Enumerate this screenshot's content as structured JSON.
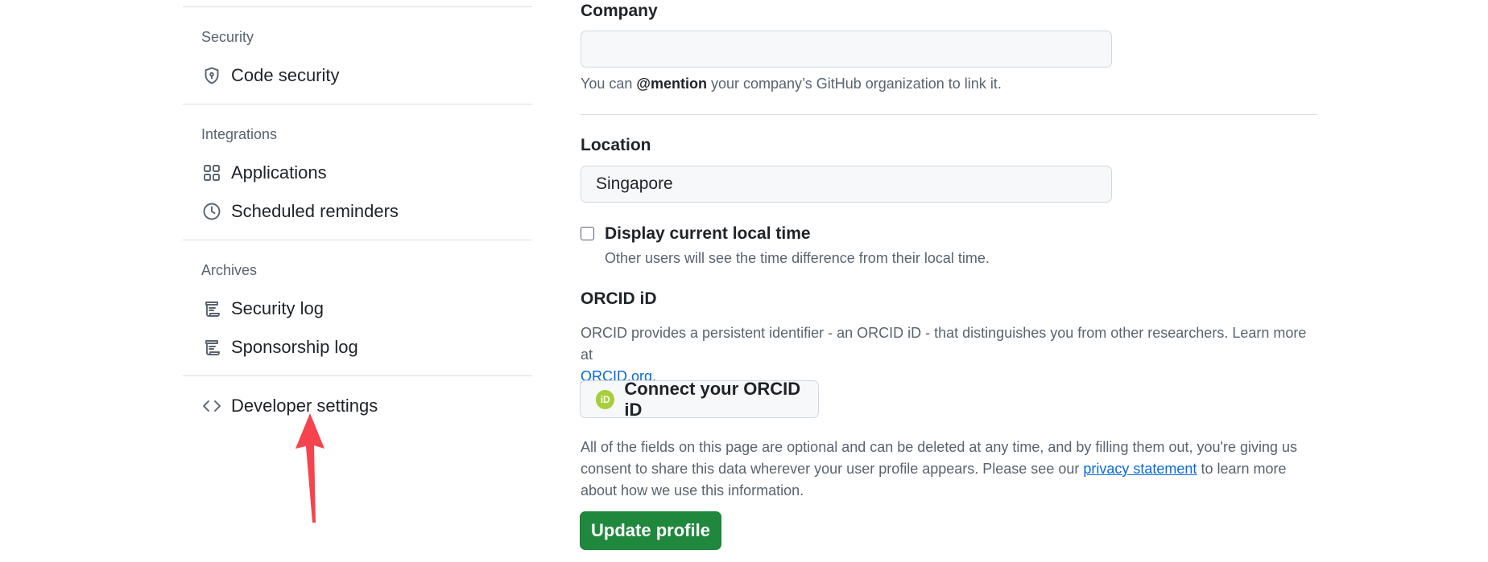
{
  "sidebar": {
    "security_header": "Security",
    "code_security": "Code security",
    "integrations_header": "Integrations",
    "applications": "Applications",
    "scheduled_reminders": "Scheduled reminders",
    "archives_header": "Archives",
    "security_log": "Security log",
    "sponsorship_log": "Sponsorship log",
    "developer_settings": "Developer settings"
  },
  "main": {
    "company": {
      "label": "Company",
      "value": "",
      "hint_prefix": "You can ",
      "hint_mention": "@mention",
      "hint_suffix": " your company’s GitHub organization to link it."
    },
    "location": {
      "label": "Location",
      "value": "Singapore"
    },
    "local_time": {
      "checked": false,
      "label": "Display current local time",
      "hint": "Other users will see the time difference from their local time."
    },
    "orcid": {
      "heading": "ORCID iD",
      "desc": "ORCID provides a persistent identifier - an ORCID iD - that distinguishes you from other researchers. Learn more at",
      "link": "ORCID.org",
      "link_suffix": ".",
      "logo_text": "iD",
      "button": "Connect your ORCID iD"
    },
    "footer_note": {
      "prefix": "All of the fields on this page are optional and can be deleted at any time, and by filling them out, you're giving us consent to share this data wherever your user profile appears. Please see our",
      "link": "privacy statement",
      "suffix": "to learn more about how we use this information."
    },
    "update_button": "Update profile"
  },
  "annotation": {
    "arrow_color": "#f5444d"
  },
  "colors": {
    "accent": "#0969da",
    "success": "#1f883d",
    "muted": "#59636e"
  }
}
